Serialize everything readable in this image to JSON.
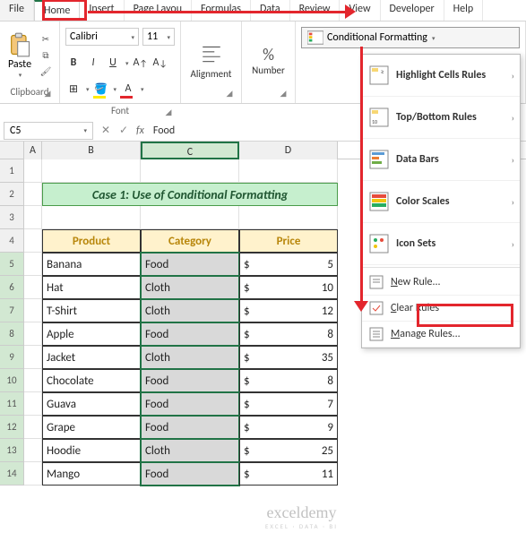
{
  "tabs": [
    "File",
    "Home",
    "Insert",
    "Page Layou",
    "Formulas",
    "Data",
    "Review",
    "View",
    "Developer",
    "Help"
  ],
  "active_tab": 1,
  "clipboard": {
    "label": "Clipboard",
    "paste": "Paste"
  },
  "font": {
    "label": "Font",
    "name": "Calibri",
    "size": "11",
    "bold": "B",
    "italic": "I",
    "underline": "U"
  },
  "alignment": {
    "label": "Alignment"
  },
  "number": {
    "label": "Number",
    "pct": "%"
  },
  "cf_button": "Conditional Formatting",
  "namebox": "C5",
  "formula_value": "Food",
  "col_headers": [
    "A",
    "B",
    "C",
    "D"
  ],
  "row_headers": [
    "1",
    "2",
    "3",
    "4",
    "5",
    "6",
    "7",
    "8",
    "9",
    "10",
    "11",
    "12",
    "13",
    "14"
  ],
  "title": "Case 1: Use of Conditional Formatting",
  "table": {
    "headers": [
      "Product",
      "Category",
      "Price"
    ],
    "rows": [
      {
        "product": "Banana",
        "category": "Food",
        "price": "5"
      },
      {
        "product": "Hat",
        "category": "Cloth",
        "price": "10"
      },
      {
        "product": "T-Shirt",
        "category": "Cloth",
        "price": "12"
      },
      {
        "product": "Apple",
        "category": "Food",
        "price": "8"
      },
      {
        "product": "Jacket",
        "category": "Cloth",
        "price": "35"
      },
      {
        "product": "Chocolate",
        "category": "Food",
        "price": "8"
      },
      {
        "product": "Guava",
        "category": "Food",
        "price": "7"
      },
      {
        "product": "Grape",
        "category": "Food",
        "price": "9"
      },
      {
        "product": "Hoodie",
        "category": "Cloth",
        "price": "25"
      },
      {
        "product": "Mango",
        "category": "Food",
        "price": "11"
      }
    ],
    "currency": "$"
  },
  "cf_menu": {
    "highlight": "Highlight Cells Rules",
    "topbottom": "Top/Bottom Rules",
    "databars": "Data Bars",
    "colorscales": "Color Scales",
    "iconsets": "Icon Sets",
    "newrule_pre": "N",
    "newrule": "ew Rule...",
    "clear_pre": "C",
    "clear": "lear Rules",
    "manage_pre": "M",
    "manage": "anage Rules..."
  },
  "watermark": {
    "brand": "exceldemy",
    "tag": "EXCEL · DATA · BI"
  }
}
